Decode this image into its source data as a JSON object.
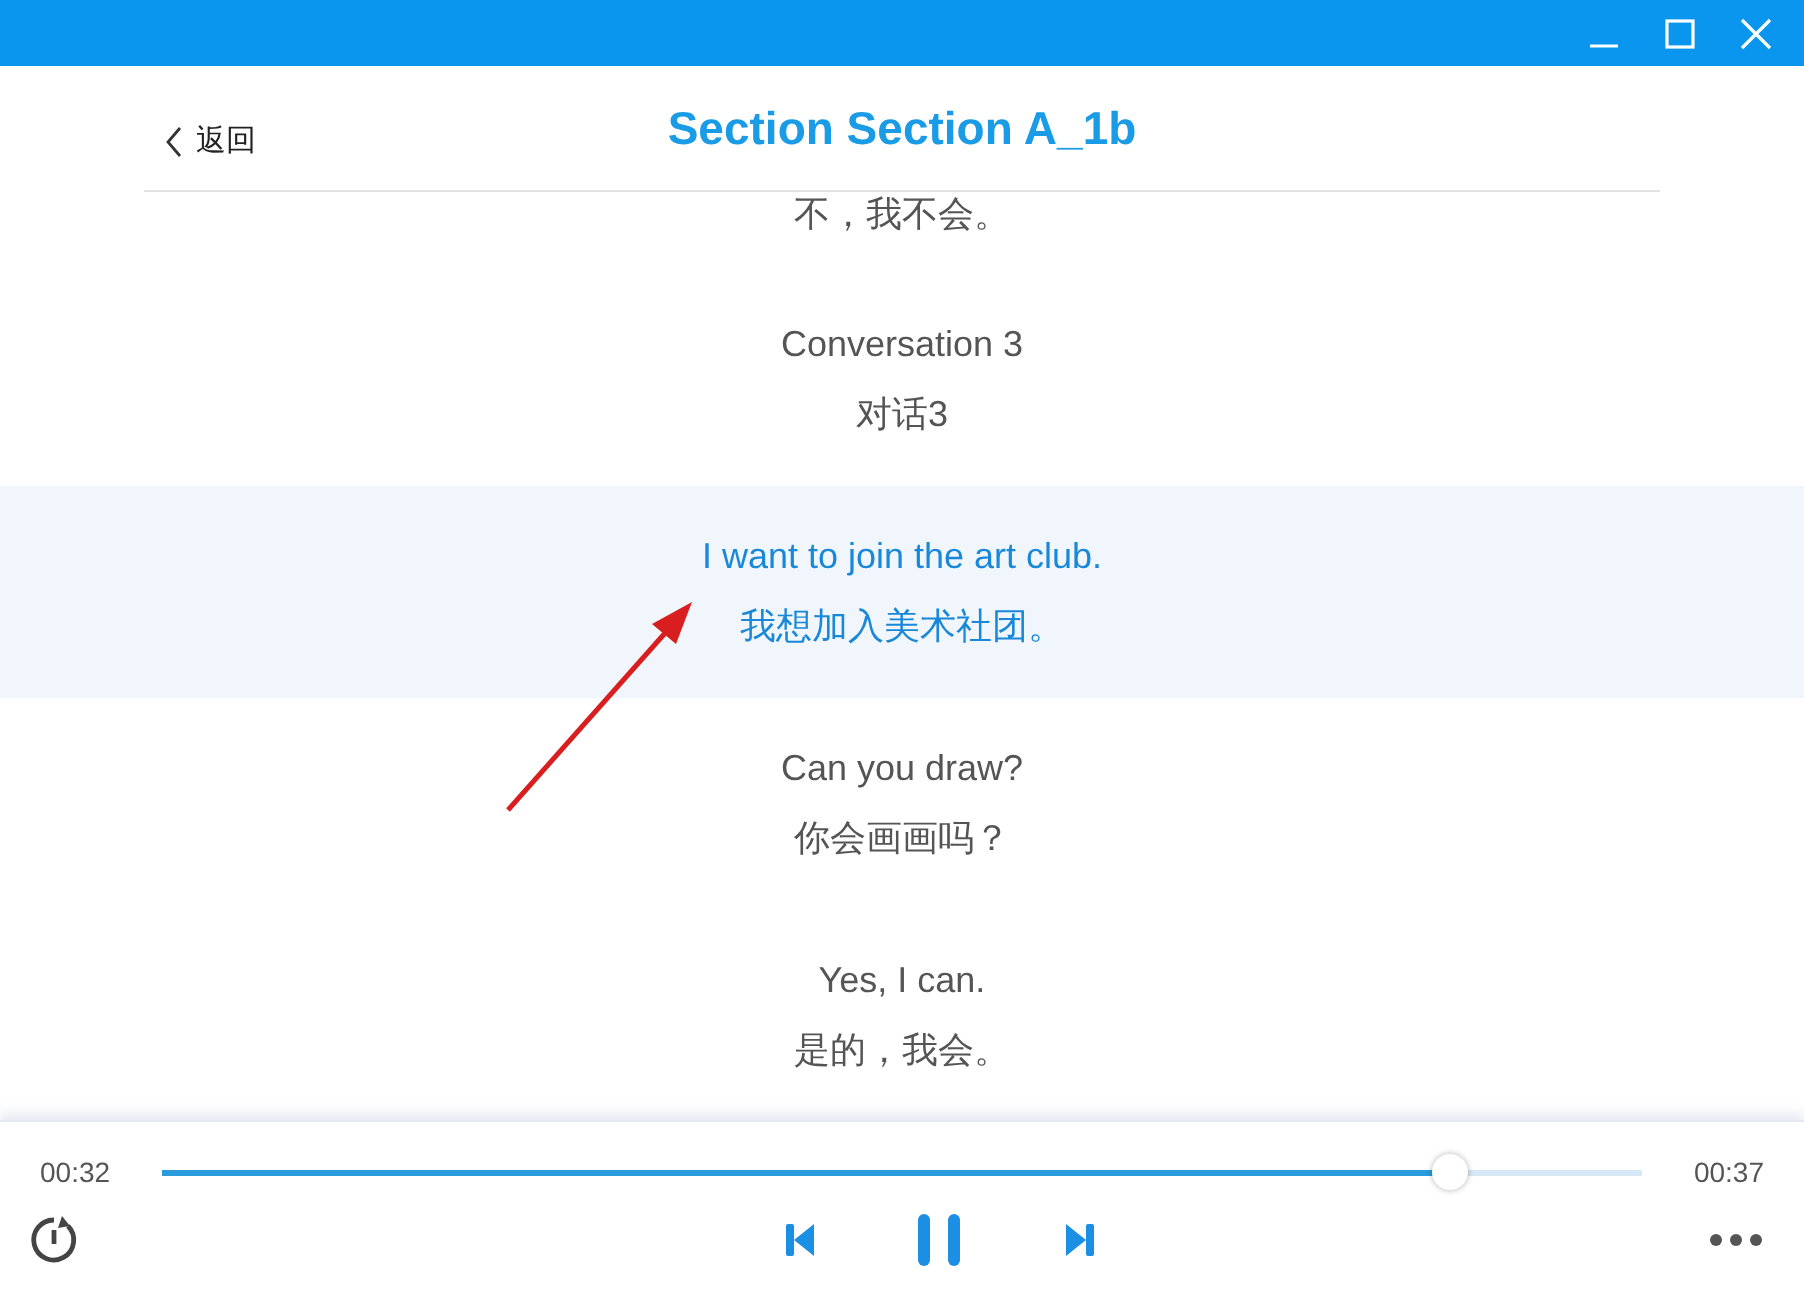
{
  "header": {
    "back_link": "返回",
    "title": "Section Section A_1b"
  },
  "lyrics": [
    {
      "zh": "不，我不会。",
      "selected": false
    },
    {
      "en": "Conversation 3",
      "zh": "对话3",
      "selected": false
    },
    {
      "en": "I want to join the art club.",
      "zh": "我想加入美术社团。",
      "selected": true
    },
    {
      "en": "Can you draw?",
      "zh": "你会画画吗？",
      "selected": false
    },
    {
      "en": "Yes, I can.",
      "zh": "是的，我会。",
      "selected": false
    }
  ],
  "player": {
    "elapsed": "00:32",
    "duration": "00:37",
    "level": 0.87,
    "playing": true
  }
}
